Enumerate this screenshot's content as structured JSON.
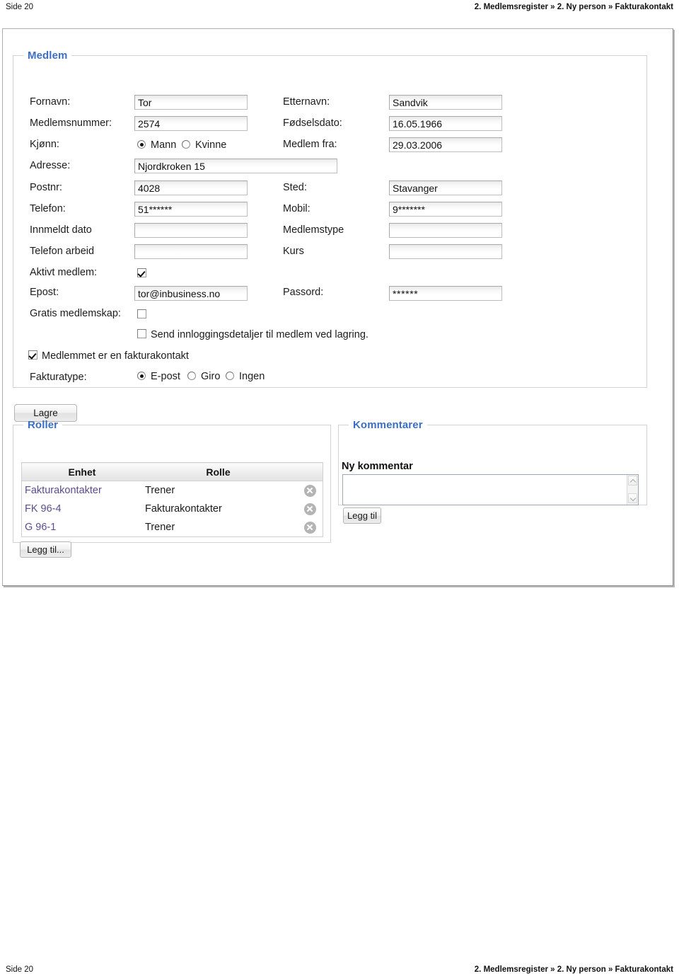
{
  "page": {
    "footer_left": "Side 20",
    "footer_right": "2. Medlemsregister » 2. Ny person » Fakturakontakt"
  },
  "medlem": {
    "legend": "Medlem",
    "fields": {
      "fornavn": {
        "label": "Fornavn:",
        "value": "Tor"
      },
      "etternavn": {
        "label": "Etternavn:",
        "value": "Sandvik"
      },
      "medlemsnummer": {
        "label": "Medlemsnummer:",
        "value": "2574"
      },
      "fodselsdato": {
        "label": "Fødselsdato:",
        "value": "16.05.1966"
      },
      "kjonn": {
        "label": "Kjønn:",
        "option_mann": "Mann",
        "option_kvinne": "Kvinne",
        "selected": "Mann"
      },
      "medlem_fra": {
        "label": "Medlem fra:",
        "value": "29.03.2006"
      },
      "adresse": {
        "label": "Adresse:",
        "value": "Njordkroken 15"
      },
      "postnr": {
        "label": "Postnr:",
        "value": "4028"
      },
      "sted": {
        "label": "Sted:",
        "value": "Stavanger"
      },
      "telefon": {
        "label": "Telefon:",
        "value": "51******"
      },
      "mobil": {
        "label": "Mobil:",
        "value": "9*******"
      },
      "innmeldt_dato": {
        "label": "Innmeldt dato",
        "value": ""
      },
      "medlemstype": {
        "label": "Medlemstype",
        "value": ""
      },
      "telefon_arbeid": {
        "label": "Telefon arbeid",
        "value": ""
      },
      "kurs": {
        "label": "Kurs",
        "value": ""
      },
      "aktivt_medlem": {
        "label": "Aktivt medlem:",
        "checked": true
      },
      "epost": {
        "label": "Epost:",
        "value": "tor@inbusiness.no"
      },
      "passord": {
        "label": "Passord:",
        "value": "******"
      },
      "gratis_medlemskap": {
        "label": "Gratis medlemskap:",
        "checked": false
      },
      "send_innlogging": {
        "label": "Send innloggingsdetaljer til medlem ved lagring.",
        "checked": false
      },
      "er_fakturakontakt": {
        "label": "Medlemmet er en fakturakontakt",
        "checked": true
      },
      "fakturatype": {
        "label": "Fakturatype:",
        "options": [
          "E-post",
          "Giro",
          "Ingen"
        ],
        "selected": "E-post"
      }
    },
    "save_button": "Lagre"
  },
  "roller": {
    "legend": "Roller",
    "columns": [
      "Enhet",
      "Rolle"
    ],
    "rows": [
      {
        "enhet": "Fakturakontakter",
        "rolle": "Trener"
      },
      {
        "enhet": "FK 96-4",
        "rolle": "Fakturakontakter"
      },
      {
        "enhet": "G 96-1",
        "rolle": "Trener"
      }
    ],
    "add_button": "Legg til..."
  },
  "kommentarer": {
    "legend": "Kommentarer",
    "ny_kommentar_label": "Ny kommentar",
    "textarea_value": "",
    "add_button": "Legg til"
  },
  "colors": {
    "legend_blue": "#3b6ec4",
    "link_purple": "#5b4b8f",
    "field_border": "#bdbdbd"
  }
}
